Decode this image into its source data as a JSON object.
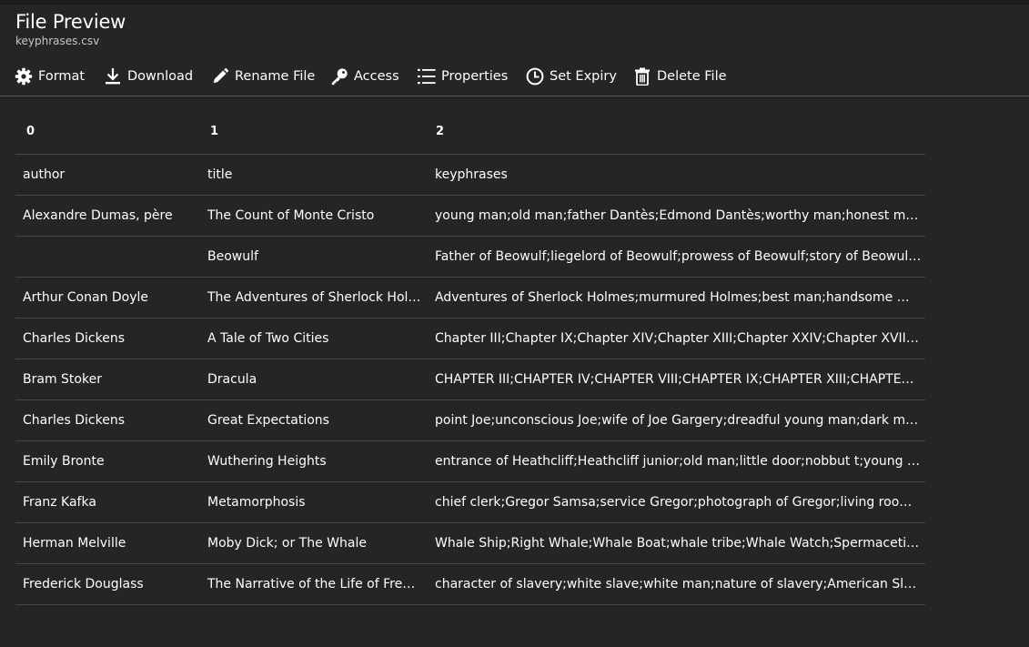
{
  "header": {
    "title": "File Preview",
    "subtitle": "keyphrases.csv"
  },
  "toolbar": {
    "items": [
      {
        "label": "Format",
        "icon": "gear-icon"
      },
      {
        "label": "Download",
        "icon": "download-icon"
      },
      {
        "label": "Rename File",
        "icon": "pencil-icon"
      },
      {
        "label": "Access",
        "icon": "key-icon"
      },
      {
        "label": "Properties",
        "icon": "list-icon"
      },
      {
        "label": "Set Expiry",
        "icon": "clock-icon"
      },
      {
        "label": "Delete File",
        "icon": "trash-icon"
      }
    ]
  },
  "table": {
    "columns": [
      "0",
      "1",
      "2"
    ],
    "rows": [
      [
        "author",
        "title",
        "keyphrases"
      ],
      [
        "Alexandre Dumas, père",
        "The Count of Monte Cristo",
        "young man;old man;father Dantès;Edmond Dantès;worthy man;honest man;cou…"
      ],
      [
        "",
        "Beowulf",
        "Father of Beowulf;liegelord of Beowulf;prowess of Beowulf;story of Beowulf;Ueb…"
      ],
      [
        "Arthur Conan Doyle",
        "The Adventures of Sherlock Holmes",
        "Adventures of Sherlock Holmes;murmured Holmes;best man;handsome man;ma…"
      ],
      [
        "Charles Dickens",
        "A Tale of Two Cities",
        "Chapter III;Chapter IX;Chapter XIV;Chapter XIII;Chapter XXIV;Chapter XVIII;Chapt…"
      ],
      [
        "Bram Stoker",
        "Dracula",
        "CHAPTER III;CHAPTER IV;CHAPTER VIII;CHAPTER IX;CHAPTER XIII;CHAPTER XIV;C…"
      ],
      [
        "Charles Dickens",
        "Great Expectations",
        "point Joe;unconscious Joe;wife of Joe Gargery;dreadful young man;dark man;ho…"
      ],
      [
        "Emily Bronte",
        "Wuthering Heights",
        "entrance of Heathcliff;Heathcliff junior;old man;little door;nobbut t;young man;li…"
      ],
      [
        "Franz Kafka",
        "Metamorphosis",
        "chief clerk;Gregor Samsa;service Gregor;photograph of Gregor;living room;wood…"
      ],
      [
        "Herman Melville",
        "Moby Dick; or The Whale",
        "Whale Ship;Right Whale;Whale Boat;whale tribe;Whale Watch;Spermaceti Whale…"
      ],
      [
        "Frederick Douglass",
        "The Narrative of the Life of Frederi…",
        "character of slavery;white slave;white man;nature of slavery;American Slave;effec…"
      ]
    ]
  },
  "colors": {
    "background": "#252526",
    "text": "#ffffff",
    "row_border": "#474747"
  }
}
